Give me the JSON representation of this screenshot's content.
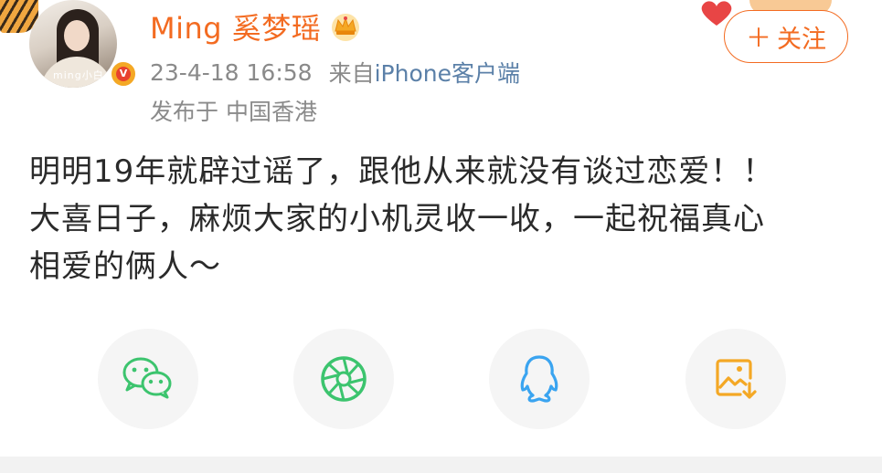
{
  "post": {
    "author": {
      "name": "Ming 奚梦瑶",
      "avatar_tag": "ming小白",
      "badge_color": "#f4a825"
    },
    "meta": {
      "time": "23-4-18 16:58",
      "source_prefix": "来自",
      "client": "iPhone客户端",
      "location": "发布于 中国香港"
    },
    "follow_label": "关注",
    "content_lines": [
      "明明19年就辟过谣了，跟他从来就没有谈过恋爱！！",
      "大喜日子，麻烦大家的小机灵收一收，一起祝福真心",
      "相爱的俩人～"
    ]
  },
  "share": [
    {
      "icon": "wechat-icon",
      "color": "#3cc46e"
    },
    {
      "icon": "moments-icon",
      "color": "#3cc46e"
    },
    {
      "icon": "qq-icon",
      "color": "#3aa4f0"
    },
    {
      "icon": "save-image-icon",
      "color": "#f4a825"
    }
  ],
  "colors": {
    "accent": "#f36b21",
    "link": "#5b80a8",
    "meta_text": "#8a8a8a",
    "body_text": "#2a2a2a"
  }
}
